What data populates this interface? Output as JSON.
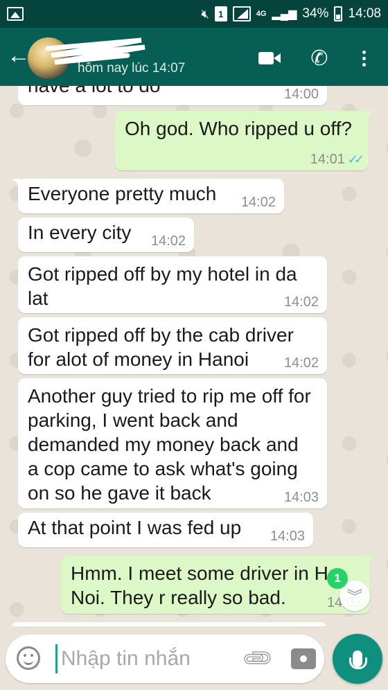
{
  "status_bar": {
    "network_label": "4G",
    "battery": "34%",
    "time": "14:08",
    "icons": [
      "image-notification-icon",
      "mute-icon",
      "sim-icon",
      "signal-icon",
      "battery-icon"
    ]
  },
  "header": {
    "subtitle": "hôm nay lúc 14:07",
    "icons": [
      "back-arrow-icon",
      "video-call-icon",
      "phone-icon",
      "more-vert-icon"
    ]
  },
  "messages": [
    {
      "dir": "in",
      "text": "have a lot to do",
      "time": "14:00"
    },
    {
      "dir": "out",
      "text": "Oh god. Who ripped u off?",
      "time": "14:01",
      "status": "read"
    },
    {
      "dir": "in",
      "text": "Everyone pretty much",
      "time": "14:02"
    },
    {
      "dir": "in",
      "text": "In every city",
      "time": "14:02"
    },
    {
      "dir": "in",
      "text": "Got ripped off by my hotel in da lat",
      "time": "14:02"
    },
    {
      "dir": "in",
      "text": "Got ripped off by the cab driver for alot of money in Hanoi",
      "time": "14:02"
    },
    {
      "dir": "in",
      "text": "Another guy tried to rip me off for parking, I went back and demanded my money back and a cop came to ask what's going on so he gave it back",
      "time": "14:03"
    },
    {
      "dir": "in",
      "text": "At that point I was fed up",
      "time": "14:03"
    },
    {
      "dir": "out",
      "text": "Hmm. I meet some driver in Ha Noi. They r really so bad.",
      "time": "14:03"
    }
  ],
  "unread_count": "1",
  "composer": {
    "placeholder": "Nhập tin nhắn",
    "icons": [
      "emoji-icon",
      "attach-icon",
      "camera-icon",
      "mic-icon"
    ]
  },
  "colors": {
    "status_bar": "#05443d",
    "header": "#075e54",
    "outgoing": "#dcf8c6",
    "incoming": "#ffffff",
    "accent": "#0f8f7e",
    "read_ticks": "#4fb6ec",
    "badge": "#25d366"
  }
}
